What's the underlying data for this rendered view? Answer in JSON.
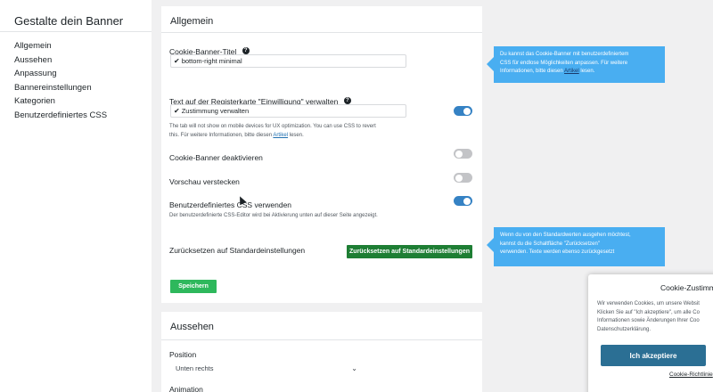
{
  "nav": {
    "title": "Gestalte dein Banner",
    "items": [
      {
        "label": "Allgemein"
      },
      {
        "label": "Aussehen"
      },
      {
        "label": "Anpassung"
      },
      {
        "label": "Bannereinstellungen"
      },
      {
        "label": "Kategorien"
      },
      {
        "label": "Benutzerdefiniertes CSS"
      }
    ]
  },
  "general": {
    "heading": "Allgemein",
    "banner_title": {
      "label": "Cookie-Banner-Titel",
      "value": "bottom-right minimal"
    },
    "tab_text": {
      "label": "Text auf der Registerkarte \"Einwilligung\" verwalten",
      "value": "Zustimmung verwalten",
      "help_line1": "The tab will not show on mobile devices for UX optimization. You can use CSS to revert",
      "help_line2_pre": "this. Für weitere Informationen, bitte diesen ",
      "help_link": "Artikel",
      "help_line2_post": " lesen.",
      "enabled": true
    },
    "disable_banner": {
      "label": "Cookie-Banner deaktivieren",
      "enabled": false
    },
    "hide_preview": {
      "label": "Vorschau verstecken",
      "enabled": false
    },
    "custom_css": {
      "label": "Benutzerdefiniertes CSS verwenden",
      "help": "Der benutzerdefinierte CSS-Editor wird bei Aktivierung unten auf dieser Seite angezeigt.",
      "enabled": true
    },
    "reset": {
      "label": "Zurücksetzen auf Standardeinstellungen",
      "button": "Zurücksetzen auf Standardeinstellungen"
    },
    "save_button": "Speichern"
  },
  "look": {
    "heading": "Aussehen",
    "position_label": "Position",
    "position_value": "Unten rechts",
    "animation_label": "Animation"
  },
  "tips": {
    "css": {
      "line1": "Du kannst das Cookie-Banner mit benutzerdefiniertem",
      "line2": "CSS für endlose Möglichkeiten anpassen. Für weitere",
      "line3_pre": "Informationen, bitte diesen ",
      "link": "Artikel",
      "line3_post": " lesen."
    },
    "reset": {
      "line1": "Wenn du von den Standardwerten ausgehen möchtest,",
      "line2": "kannst du die Schaltfläche \"Zurücksetzen\"",
      "line3": "verwenden. Texte werden ebenso zurückgesetzt"
    }
  },
  "cookie_preview": {
    "title": "Cookie-Zustimm",
    "lines": [
      "Wir verwenden Cookies, um unsere Websit",
      "Klicken Sie auf \"Ich akzeptiere\", um alle Co",
      "Informationen sowie Änderungen Ihrer Coo",
      "Datenschutzerklärung."
    ],
    "accept_button": "Ich akzeptiere",
    "link": "Cookie-Richtlinie"
  },
  "colors": {
    "toggle_on": "#3582c4",
    "toggle_off": "#c3c4c7",
    "reset_button": "#1e7e34",
    "save_button": "#2eb85c",
    "tooltip": "#49aef1",
    "accept_button": "#2b6f94"
  }
}
